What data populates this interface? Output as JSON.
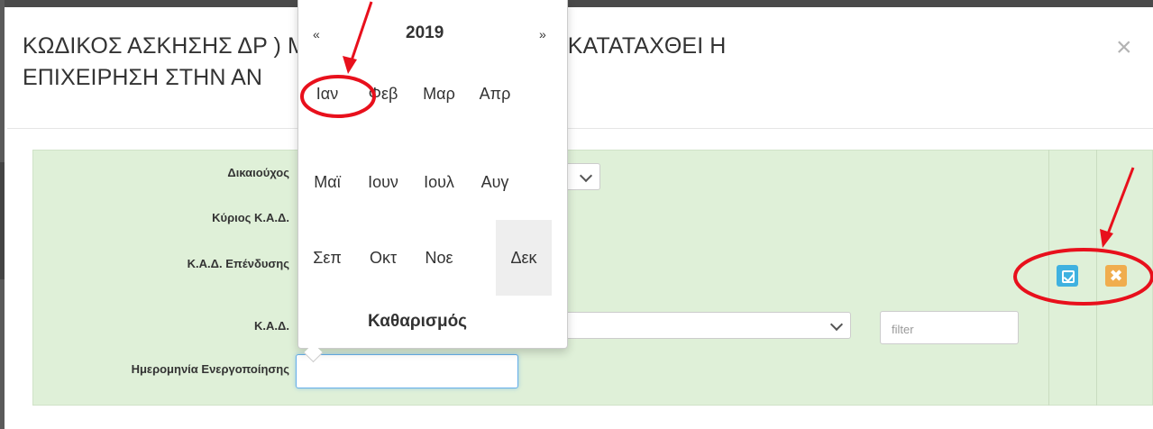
{
  "modal": {
    "title": "ΚΩΔΙΚΟΣ ΑΣΚΗΣΗΣ ΔΡ                              ) ΜΕ ΒΑΣΗ ΤΟΝ ΟΠΟΙΟ ΘΑ ΚΑΤΑΤΑΧΘΕΙ Η\nΕΠΙΧΕΙΡΗΣΗ ΣΤΗΝ ΑΝ",
    "close_symbol": "×"
  },
  "form": {
    "labels": {
      "beneficiary": "Δικαιούχος",
      "main_kad": "Κύριος Κ.Α.Δ.",
      "investment_kad": "Κ.Α.Δ. Επένδυσης",
      "kad": "Κ.Α.Δ.",
      "activation_date": "Ημερομηνία Ενεργοποίησης"
    },
    "filter_placeholder": "filter",
    "activation_date_value": ""
  },
  "actions": {
    "edit_icon": "edit-check-icon",
    "cancel_icon": "close-icon",
    "cancel_symbol": "✖"
  },
  "datepicker": {
    "prev": "«",
    "next": "»",
    "year": "2019",
    "months": [
      "Ιαν",
      "Φεβ",
      "Μαρ",
      "Απρ",
      "Μαϊ",
      "Ιουν",
      "Ιουλ",
      "Αυγ",
      "Σεπ",
      "Οκτ",
      "Νοε",
      "Δεκ"
    ],
    "clear_label": "Καθαρισμός",
    "highlighted_month": "Δεκ"
  },
  "colors": {
    "form_background": "#dff0d8",
    "edit_button": "#3fb1e0",
    "cancel_button": "#f0ad4e",
    "annotation": "#e8101c"
  }
}
